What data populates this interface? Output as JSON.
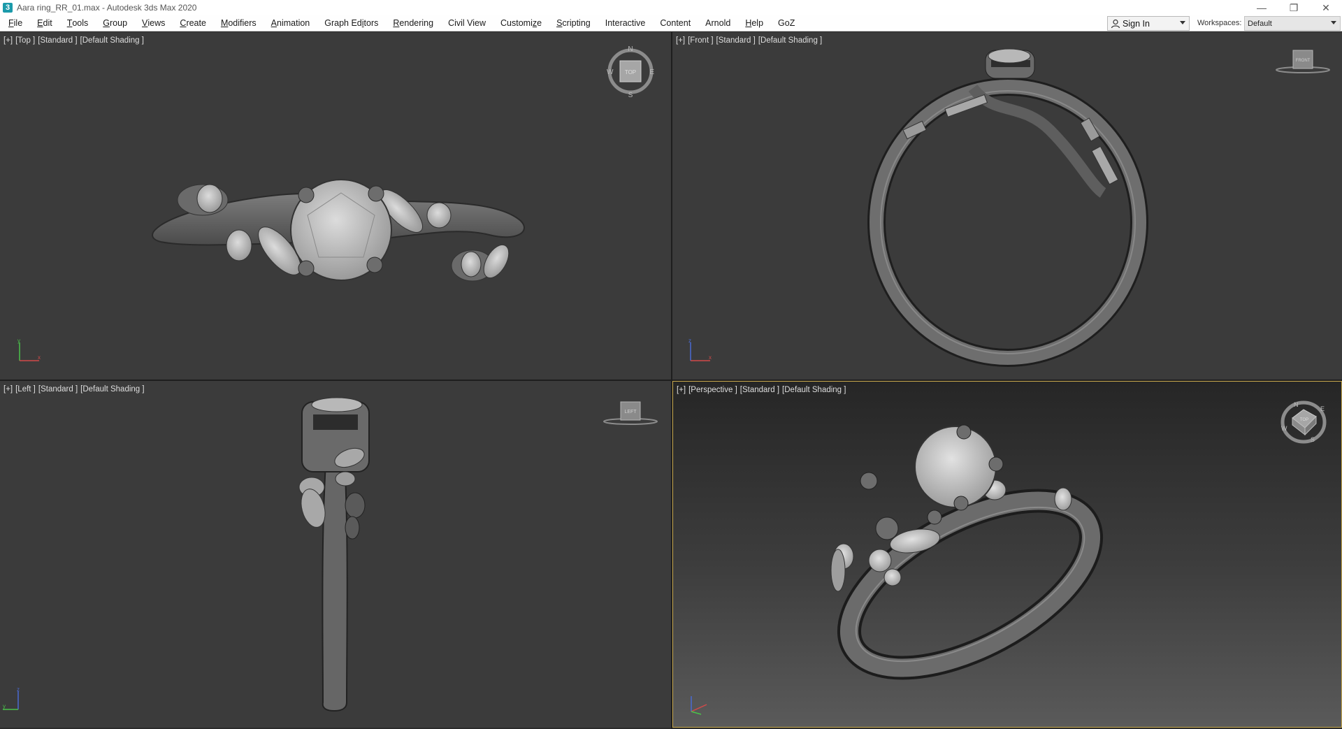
{
  "window": {
    "title": "Aara ring_RR_01.max - Autodesk 3ds Max 2020",
    "app_icon_glyph": "3",
    "controls": {
      "minimize": "—",
      "restore": "❐",
      "close": "✕"
    }
  },
  "menubar": {
    "items": [
      {
        "pre": "",
        "u": "F",
        "post": "ile"
      },
      {
        "pre": "",
        "u": "E",
        "post": "dit"
      },
      {
        "pre": "",
        "u": "T",
        "post": "ools"
      },
      {
        "pre": "",
        "u": "G",
        "post": "roup"
      },
      {
        "pre": "",
        "u": "V",
        "post": "iews"
      },
      {
        "pre": "",
        "u": "C",
        "post": "reate"
      },
      {
        "pre": "",
        "u": "M",
        "post": "odifiers"
      },
      {
        "pre": "",
        "u": "A",
        "post": "nimation"
      },
      {
        "pre": "Graph Ed",
        "u": "i",
        "post": "tors"
      },
      {
        "pre": "",
        "u": "R",
        "post": "endering"
      },
      {
        "pre": "Civil View",
        "u": "",
        "post": ""
      },
      {
        "pre": "Customi",
        "u": "z",
        "post": "e"
      },
      {
        "pre": "",
        "u": "S",
        "post": "cripting"
      },
      {
        "pre": "Interactive",
        "u": "",
        "post": ""
      },
      {
        "pre": "Content",
        "u": "",
        "post": ""
      },
      {
        "pre": "Arnold",
        "u": "",
        "post": ""
      },
      {
        "pre": "",
        "u": "H",
        "post": "elp"
      },
      {
        "pre": "GoZ",
        "u": "",
        "post": ""
      }
    ],
    "sign_in": "Sign In",
    "workspaces_label": "Workspaces:",
    "workspace_value": "Default"
  },
  "viewports": {
    "top": {
      "labels": [
        "[+]",
        "[Top ]",
        "[Standard ]",
        "[Default Shading ]"
      ],
      "gizmo_text": "TOP",
      "compass": [
        "N",
        "S",
        "E",
        "W"
      ]
    },
    "front": {
      "labels": [
        "[+]",
        "[Front ]",
        "[Standard ]",
        "[Default Shading ]"
      ],
      "gizmo_text": "FRONT"
    },
    "left": {
      "labels": [
        "[+]",
        "[Left ]",
        "[Standard ]",
        "[Default Shading ]"
      ],
      "gizmo_text": "LEFT"
    },
    "perspective": {
      "labels": [
        "[+]",
        "[Perspective ]",
        "[Standard ]",
        "[Default Shading ]"
      ],
      "gizmo_text": "TOP",
      "compass": [
        "N",
        "E",
        "W",
        "S"
      ],
      "active": true
    }
  },
  "colors": {
    "viewport_bg": "#3b3b3b",
    "active_border": "#c9a94d",
    "axis_x": "#d24a4a",
    "axis_y": "#4ac24a",
    "axis_z": "#4a6ad2"
  }
}
